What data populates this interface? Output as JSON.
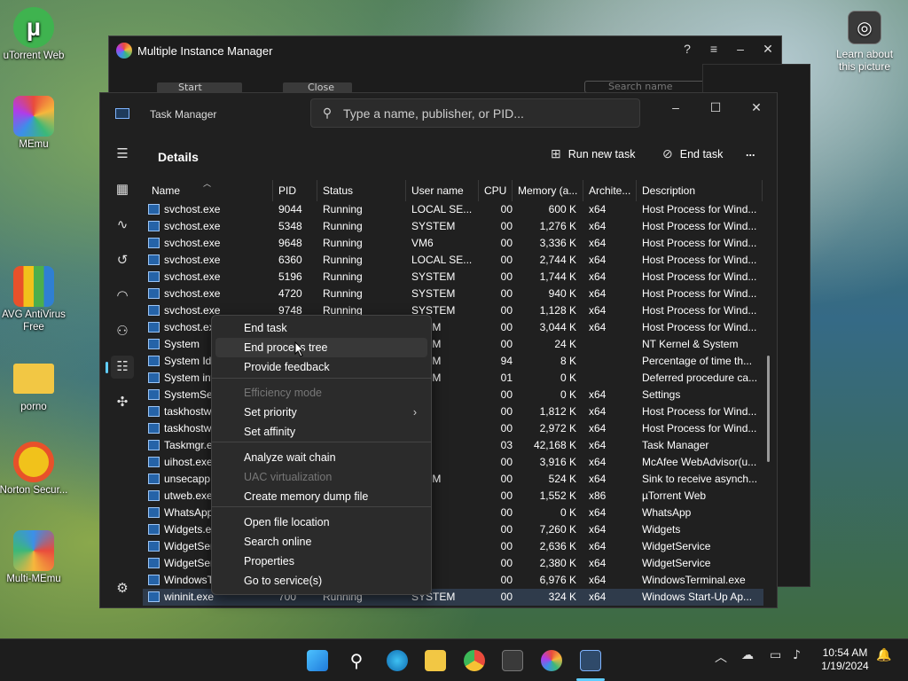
{
  "desktop": {
    "icons": [
      {
        "label": "uTorrent Web",
        "color": "#3fb34f"
      },
      {
        "label": "MEmu",
        "color": "#4a7bd8"
      },
      {
        "label": "AVG AntiVirus Free",
        "color": "#e8512a"
      },
      {
        "label": "porno",
        "color": "#f2c744"
      },
      {
        "label": "Norton Secur...",
        "color": "#f1c21b"
      },
      {
        "label": "Multi-MEmu",
        "color": "#5a7fe0"
      }
    ],
    "learn": "Learn about this picture"
  },
  "mim": {
    "title": "Multiple Instance Manager",
    "start": "Start",
    "close": "Close",
    "search_placeholder": "Search name"
  },
  "taskmgr": {
    "title": "Task Manager",
    "search_placeholder": "Type a name, publisher, or PID...",
    "section": "Details",
    "run_new_task": "Run new task",
    "end_task": "End task",
    "more": "...",
    "columns": [
      "Name",
      "PID",
      "Status",
      "User name",
      "CPU",
      "Memory (a...",
      "Archite...",
      "Description"
    ],
    "rows": [
      {
        "name": "svchost.exe",
        "pid": "9044",
        "status": "Running",
        "user": "LOCAL SE...",
        "cpu": "00",
        "mem": "600 K",
        "arch": "x64",
        "desc": "Host Process for Wind..."
      },
      {
        "name": "svchost.exe",
        "pid": "5348",
        "status": "Running",
        "user": "SYSTEM",
        "cpu": "00",
        "mem": "1,276 K",
        "arch": "x64",
        "desc": "Host Process for Wind..."
      },
      {
        "name": "svchost.exe",
        "pid": "9648",
        "status": "Running",
        "user": "VM6",
        "cpu": "00",
        "mem": "3,336 K",
        "arch": "x64",
        "desc": "Host Process for Wind..."
      },
      {
        "name": "svchost.exe",
        "pid": "6360",
        "status": "Running",
        "user": "LOCAL SE...",
        "cpu": "00",
        "mem": "2,744 K",
        "arch": "x64",
        "desc": "Host Process for Wind..."
      },
      {
        "name": "svchost.exe",
        "pid": "5196",
        "status": "Running",
        "user": "SYSTEM",
        "cpu": "00",
        "mem": "1,744 K",
        "arch": "x64",
        "desc": "Host Process for Wind..."
      },
      {
        "name": "svchost.exe",
        "pid": "4720",
        "status": "Running",
        "user": "SYSTEM",
        "cpu": "00",
        "mem": "940 K",
        "arch": "x64",
        "desc": "Host Process for Wind..."
      },
      {
        "name": "svchost.exe",
        "pid": "9748",
        "status": "Running",
        "user": "SYSTEM",
        "cpu": "00",
        "mem": "1,128 K",
        "arch": "x64",
        "desc": "Host Process for Wind..."
      },
      {
        "name": "svchost.exe",
        "pid": "",
        "status": "",
        "user": "STEM",
        "cpu": "00",
        "mem": "3,044 K",
        "arch": "x64",
        "desc": "Host Process for Wind..."
      },
      {
        "name": "System",
        "pid": "",
        "status": "",
        "user": "STEM",
        "cpu": "00",
        "mem": "24 K",
        "arch": "",
        "desc": "NT Kernel & System"
      },
      {
        "name": "System Idl",
        "pid": "",
        "status": "",
        "user": "STEM",
        "cpu": "94",
        "mem": "8 K",
        "arch": "",
        "desc": "Percentage of time th..."
      },
      {
        "name": "System int",
        "pid": "",
        "status": "",
        "user": "STEM",
        "cpu": "01",
        "mem": "0 K",
        "arch": "",
        "desc": "Deferred procedure ca..."
      },
      {
        "name": "SystemSet",
        "pid": "",
        "status": "",
        "user": "",
        "cpu": "00",
        "mem": "0 K",
        "arch": "x64",
        "desc": "Settings"
      },
      {
        "name": "taskhostw",
        "pid": "",
        "status": "",
        "user": "",
        "cpu": "00",
        "mem": "1,812 K",
        "arch": "x64",
        "desc": "Host Process for Wind..."
      },
      {
        "name": "taskhostw",
        "pid": "",
        "status": "",
        "user": "",
        "cpu": "00",
        "mem": "2,972 K",
        "arch": "x64",
        "desc": "Host Process for Wind..."
      },
      {
        "name": "Taskmgr.e",
        "pid": "",
        "status": "",
        "user": "",
        "cpu": "03",
        "mem": "42,168 K",
        "arch": "x64",
        "desc": "Task Manager"
      },
      {
        "name": "uihost.exe",
        "pid": "",
        "status": "",
        "user": "",
        "cpu": "00",
        "mem": "3,916 K",
        "arch": "x64",
        "desc": "McAfee WebAdvisor(u..."
      },
      {
        "name": "unsecapp.",
        "pid": "",
        "status": "",
        "user": "STEM",
        "cpu": "00",
        "mem": "524 K",
        "arch": "x64",
        "desc": "Sink to receive asynch..."
      },
      {
        "name": "utweb.exe",
        "pid": "",
        "status": "",
        "user": "",
        "cpu": "00",
        "mem": "1,552 K",
        "arch": "x86",
        "desc": "µTorrent Web"
      },
      {
        "name": "WhatsApp",
        "pid": "",
        "status": "",
        "user": "",
        "cpu": "00",
        "mem": "0 K",
        "arch": "x64",
        "desc": "WhatsApp"
      },
      {
        "name": "Widgets.ex",
        "pid": "",
        "status": "",
        "user": "",
        "cpu": "00",
        "mem": "7,260 K",
        "arch": "x64",
        "desc": "Widgets"
      },
      {
        "name": "WidgetSer",
        "pid": "",
        "status": "",
        "user": "",
        "cpu": "00",
        "mem": "2,636 K",
        "arch": "x64",
        "desc": "WidgetService"
      },
      {
        "name": "WidgetSer",
        "pid": "",
        "status": "",
        "user": "",
        "cpu": "00",
        "mem": "2,380 K",
        "arch": "x64",
        "desc": "WidgetService"
      },
      {
        "name": "WindowsT",
        "pid": "",
        "status": "",
        "user": "",
        "cpu": "00",
        "mem": "6,976 K",
        "arch": "x64",
        "desc": "WindowsTerminal.exe"
      },
      {
        "name": "wininit.exe",
        "pid": "700",
        "status": "Running",
        "user": "SYSTEM",
        "cpu": "00",
        "mem": "324 K",
        "arch": "x64",
        "desc": "Windows Start-Up Ap..."
      }
    ]
  },
  "context_menu": {
    "items": [
      {
        "label": "End task",
        "disabled": false
      },
      {
        "label": "End process tree",
        "disabled": false
      },
      {
        "label": "Provide feedback",
        "disabled": false
      },
      {
        "label": "Efficiency mode",
        "disabled": true
      },
      {
        "label": "Set priority",
        "disabled": false,
        "submenu": true
      },
      {
        "label": "Set affinity",
        "disabled": false
      },
      {
        "label": "Analyze wait chain",
        "disabled": false
      },
      {
        "label": "UAC virtualization",
        "disabled": true
      },
      {
        "label": "Create memory dump file",
        "disabled": false
      },
      {
        "label": "Open file location",
        "disabled": false
      },
      {
        "label": "Search online",
        "disabled": false
      },
      {
        "label": "Properties",
        "disabled": false
      },
      {
        "label": "Go to service(s)",
        "disabled": false
      }
    ]
  },
  "taskbar": {
    "time": "10:54 AM",
    "date": "1/19/2024"
  }
}
